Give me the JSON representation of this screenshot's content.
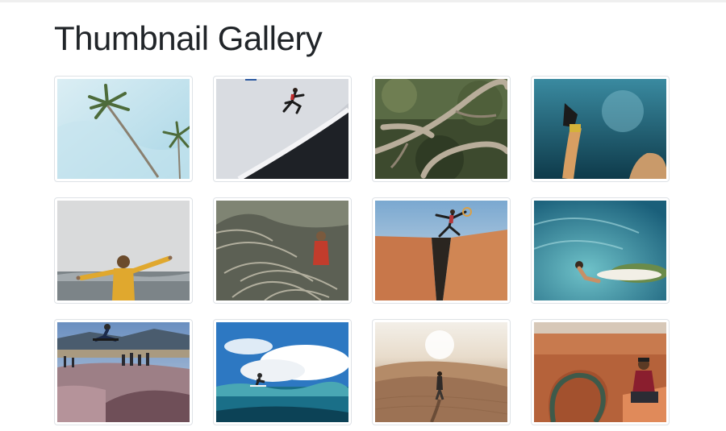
{
  "page": {
    "title": "Thumbnail Gallery"
  },
  "gallery": {
    "items": [
      {
        "name": "palm-trees-sky-photo"
      },
      {
        "name": "skater-jumping-wall-photo"
      },
      {
        "name": "tree-branches-photo"
      },
      {
        "name": "underwater-diver-fins-photo"
      },
      {
        "name": "person-yellow-jacket-sea-photo"
      },
      {
        "name": "person-in-dune-grass-photo"
      },
      {
        "name": "man-jumping-canyon-gap-photo"
      },
      {
        "name": "surfer-in-wave-barrel-photo"
      },
      {
        "name": "skatepark-jump-photo"
      },
      {
        "name": "surfer-ocean-clouds-photo"
      },
      {
        "name": "person-in-desert-dunes-photo"
      },
      {
        "name": "man-at-horseshoe-bend-photo"
      }
    ]
  },
  "colors": {
    "title": "#212529",
    "thumb_border": "#dee2e6",
    "page_background": "#ffffff"
  }
}
